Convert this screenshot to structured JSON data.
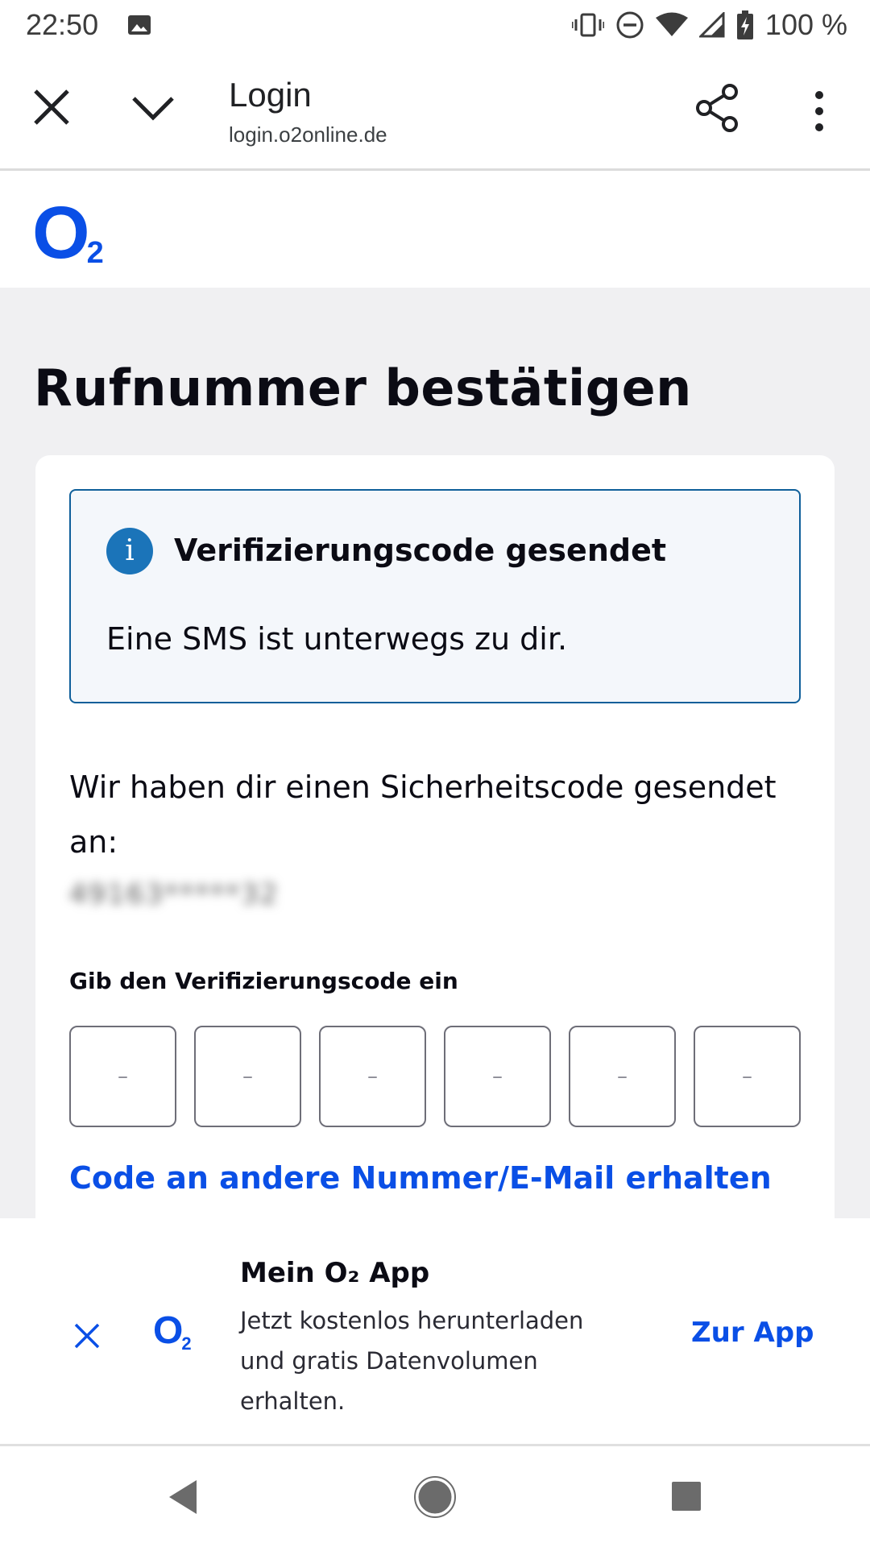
{
  "status_bar": {
    "time": "22:50",
    "battery_percent": "100 %",
    "icons": [
      "image-icon",
      "vibrate-icon",
      "do-not-disturb-icon",
      "wifi-icon",
      "cell-signal-icon",
      "battery-charging-icon"
    ]
  },
  "toolbar": {
    "title": "Login",
    "url": "login.o2online.de",
    "icons": [
      "close-icon",
      "chevron-down-icon",
      "share-icon",
      "more-vert-icon"
    ]
  },
  "brand": {
    "logo_o": "O",
    "logo_sub": "2",
    "accent_color": "#0a4fe6"
  },
  "page": {
    "title": "Rufnummer bestätigen"
  },
  "info_box": {
    "icon": "i",
    "title": "Verifizierungscode gesendet",
    "text": "Eine SMS ist unterwegs zu dir.",
    "border_color": "#0f5f9a"
  },
  "verification": {
    "sent_text": "Wir haben dir einen Sicherheitscode gesendet an:",
    "masked_number": "49163*****32",
    "code_label": "Gib den Verifizierungscode ein",
    "code_placeholders": [
      "–",
      "–",
      "–",
      "–",
      "–",
      "–"
    ],
    "alt_link": "Code an andere Nummer/E-Mail erhalten"
  },
  "app_banner": {
    "title": "Mein O₂ App",
    "text": "Jetzt kostenlos herunterladen und gratis Datenvolumen erhalten.",
    "cta": "Zur App",
    "logo_o": "O",
    "logo_sub": "2"
  },
  "nav_bar": {
    "icons": [
      "back-icon",
      "home-icon",
      "recents-icon"
    ]
  }
}
